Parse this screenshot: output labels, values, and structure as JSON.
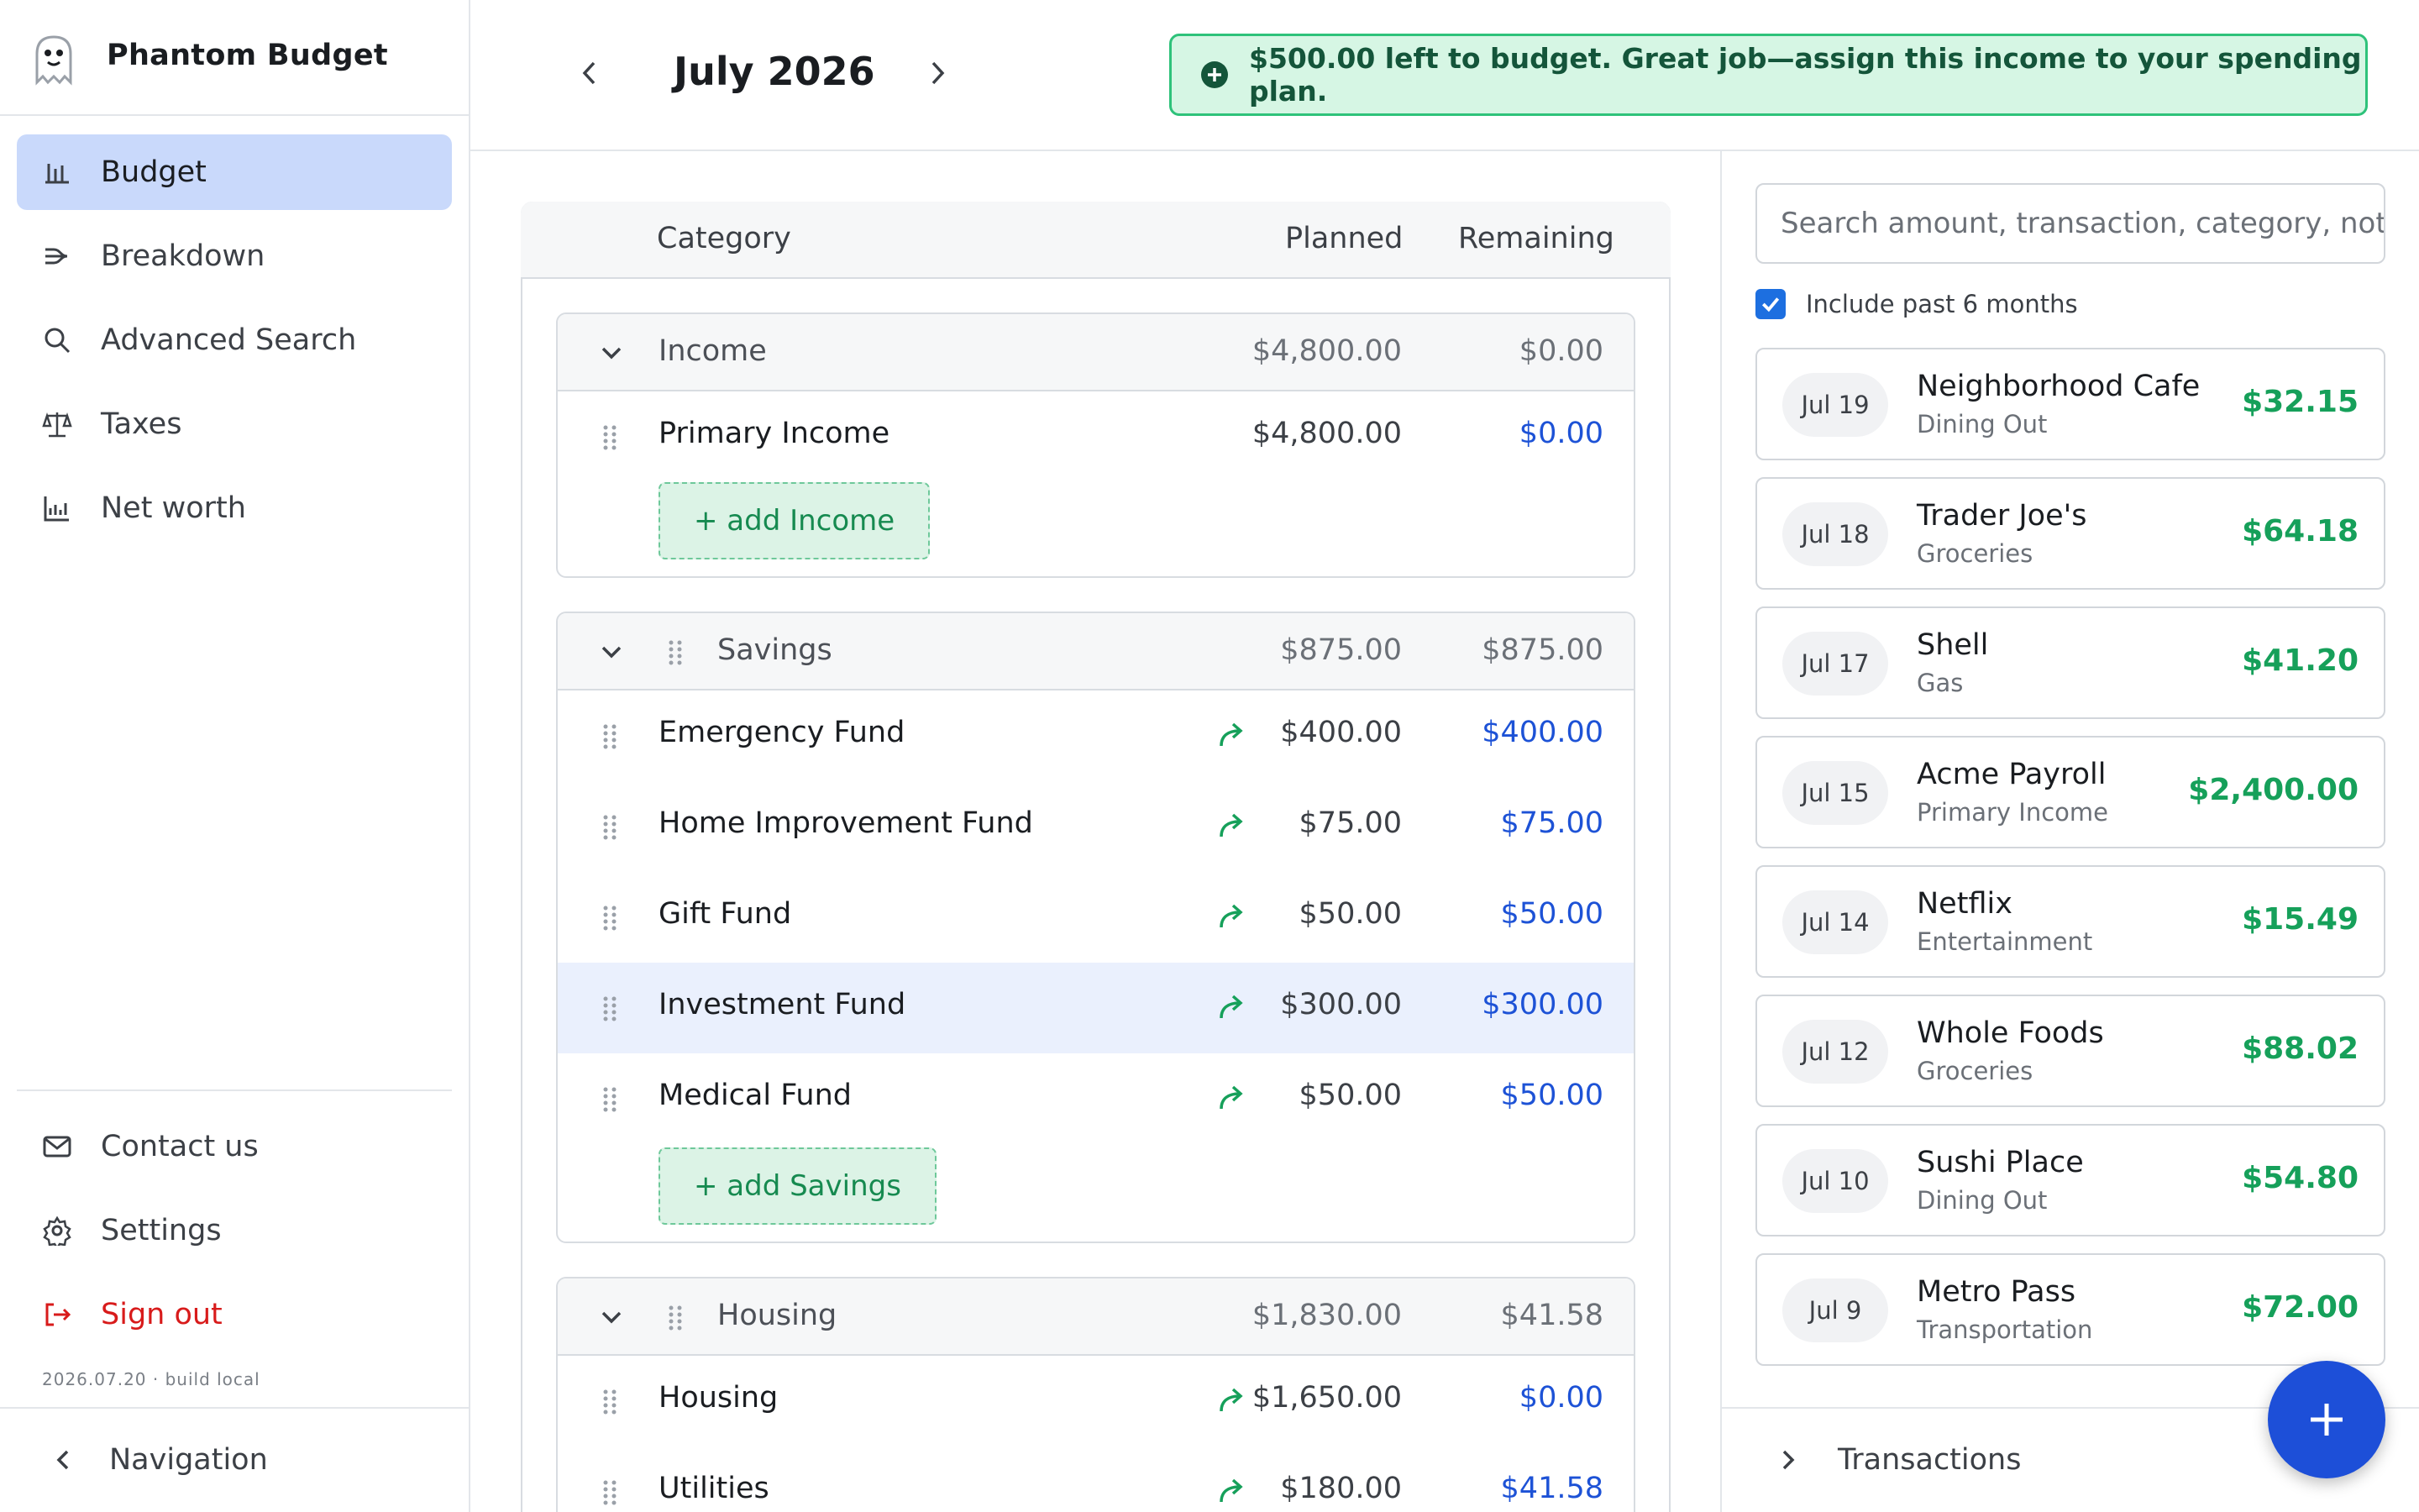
{
  "app": {
    "name": "Phantom Budget",
    "build": "2026.07.20 · build local"
  },
  "sidebar": {
    "items": [
      {
        "label": "Budget",
        "icon": "bar-chart-icon"
      },
      {
        "label": "Breakdown",
        "icon": "sankey-icon"
      },
      {
        "label": "Advanced Search",
        "icon": "search-icon"
      },
      {
        "label": "Taxes",
        "icon": "scale-icon"
      },
      {
        "label": "Net worth",
        "icon": "line-chart-icon"
      }
    ],
    "bottom": [
      {
        "label": "Contact us",
        "icon": "mail-icon"
      },
      {
        "label": "Settings",
        "icon": "gear-icon"
      },
      {
        "label": "Sign out",
        "icon": "sign-out-icon"
      }
    ],
    "footer_label": "Navigation"
  },
  "header": {
    "month": "July 2026",
    "banner": "$500.00 left to budget. Great job—assign this income to your spending plan."
  },
  "table": {
    "columns": {
      "category": "Category",
      "planned": "Planned",
      "remaining": "Remaining"
    },
    "groups": [
      {
        "name": "Income",
        "planned": "$4,800.00",
        "remaining": "$0.00",
        "rows": [
          {
            "name": "Primary Income",
            "planned": "$4,800.00",
            "remaining": "$0.00"
          }
        ],
        "add_label": "+ add Income"
      },
      {
        "name": "Savings",
        "planned": "$875.00",
        "remaining": "$875.00",
        "rows": [
          {
            "name": "Emergency Fund",
            "planned": "$400.00",
            "remaining": "$400.00"
          },
          {
            "name": "Home Improvement Fund",
            "planned": "$75.00",
            "remaining": "$75.00"
          },
          {
            "name": "Gift Fund",
            "planned": "$50.00",
            "remaining": "$50.00"
          },
          {
            "name": "Investment Fund",
            "planned": "$300.00",
            "remaining": "$300.00"
          },
          {
            "name": "Medical Fund",
            "planned": "$50.00",
            "remaining": "$50.00"
          }
        ],
        "add_label": "+ add Savings"
      },
      {
        "name": "Housing",
        "planned": "$1,830.00",
        "remaining": "$41.58",
        "rows": [
          {
            "name": "Housing",
            "planned": "$1,650.00",
            "remaining": "$0.00"
          },
          {
            "name": "Utilities",
            "planned": "$180.00",
            "remaining": "$41.58"
          }
        ]
      }
    ]
  },
  "transactions": {
    "search_placeholder": "Search amount, transaction, category, notes",
    "include_past_label": "Include past 6 months",
    "include_past_checked": true,
    "items": [
      {
        "date": "Jul 19",
        "name": "Neighborhood Cafe",
        "category": "Dining Out",
        "amount": "$32.15"
      },
      {
        "date": "Jul 18",
        "name": "Trader Joe's",
        "category": "Groceries",
        "amount": "$64.18"
      },
      {
        "date": "Jul 17",
        "name": "Shell",
        "category": "Gas",
        "amount": "$41.20"
      },
      {
        "date": "Jul 15",
        "name": "Acme Payroll",
        "category": "Primary Income",
        "amount": "$2,400.00"
      },
      {
        "date": "Jul 14",
        "name": "Netflix",
        "category": "Entertainment",
        "amount": "$15.49"
      },
      {
        "date": "Jul 12",
        "name": "Whole Foods",
        "category": "Groceries",
        "amount": "$88.02"
      },
      {
        "date": "Jul 10",
        "name": "Sushi Place",
        "category": "Dining Out",
        "amount": "$54.80"
      },
      {
        "date": "Jul 9",
        "name": "Metro Pass",
        "category": "Transportation",
        "amount": "$72.00"
      }
    ],
    "footer_label": "Transactions"
  },
  "colors": {
    "accent": "#1d4fd8",
    "active_nav": "#c9d9fb",
    "positive": "#16a05a",
    "remaining_blue": "#1d52d6",
    "danger": "#d81b1b",
    "banner_bg": "#d6f6e4"
  }
}
